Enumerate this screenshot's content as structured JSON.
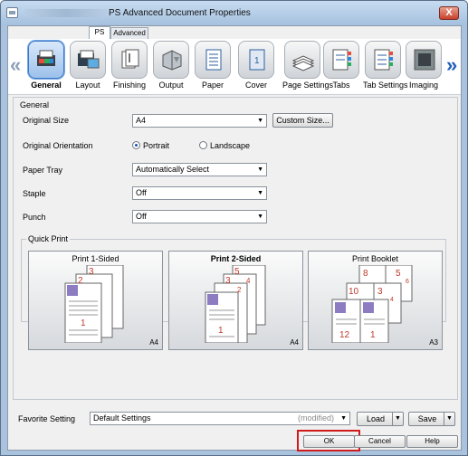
{
  "window": {
    "title": "PS Advanced Document Properties",
    "close_label": "X"
  },
  "tabs": [
    {
      "label": "PS"
    },
    {
      "label": "Advanced"
    }
  ],
  "categories": [
    {
      "label": "General",
      "icon": "general-icon"
    },
    {
      "label": "Layout",
      "icon": "layout-icon"
    },
    {
      "label": "Finishing",
      "icon": "finishing-icon"
    },
    {
      "label": "Output",
      "icon": "output-icon"
    },
    {
      "label": "Paper",
      "icon": "paper-icon"
    },
    {
      "label": "Cover",
      "icon": "cover-icon"
    },
    {
      "label": "Page Settings",
      "icon": "page-settings-icon"
    },
    {
      "label": "Tabs",
      "icon": "tabs-icon"
    },
    {
      "label": "Tab Settings",
      "icon": "tab-settings-icon"
    },
    {
      "label": "Imaging",
      "icon": "imaging-icon"
    }
  ],
  "nav": {
    "left": "«",
    "right": "»"
  },
  "general": {
    "title": "General",
    "original_size": {
      "label": "Original Size",
      "value": "A4",
      "custom_button": "Custom Size..."
    },
    "orientation": {
      "label": "Original Orientation",
      "portrait": "Portrait",
      "landscape": "Landscape",
      "selected": "Portrait"
    },
    "paper_tray": {
      "label": "Paper Tray",
      "value": "Automatically Select"
    },
    "staple": {
      "label": "Staple",
      "value": "Off"
    },
    "punch": {
      "label": "Punch",
      "value": "Off"
    }
  },
  "quick_print": {
    "title": "Quick Print",
    "options": [
      {
        "label": "Print 1-Sided",
        "paper": "A4",
        "pages": [
          "3",
          "2",
          "1"
        ]
      },
      {
        "label": "Print 2-Sided",
        "paper": "A4",
        "pages": [
          "5",
          "4",
          "3",
          "2",
          "1"
        ]
      },
      {
        "label": "Print Booklet",
        "paper": "A3",
        "pages": [
          "8",
          "5",
          "6",
          "10",
          "3",
          "4",
          "12",
          "1"
        ]
      }
    ]
  },
  "favorite": {
    "label": "Favorite Setting",
    "value": "Default Settings",
    "modified": "(modified)",
    "load": "Load",
    "save": "Save"
  },
  "buttons": {
    "ok": "OK",
    "cancel": "Cancel",
    "help": "Help"
  },
  "colors": {
    "title_bar": "#a9c3de",
    "highlight": "#d11b1b",
    "page_number": "#c0392b"
  }
}
